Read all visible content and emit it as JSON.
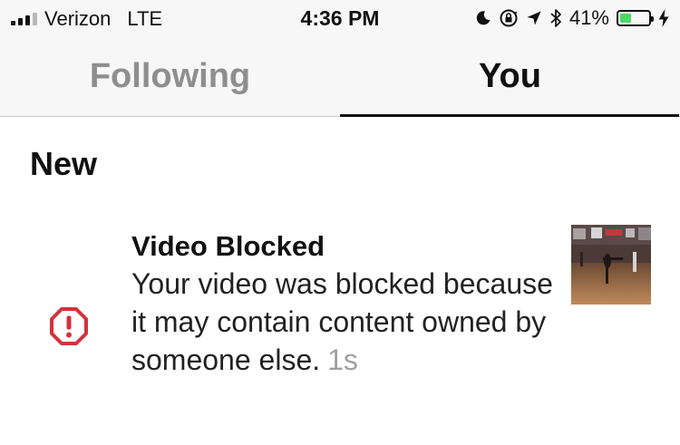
{
  "status_bar": {
    "carrier": "Verizon",
    "network": "LTE",
    "time": "4:36 PM",
    "battery_percent": "41%",
    "battery_level": 0.41,
    "icons": [
      "do-not-disturb-icon",
      "rotation-lock-icon",
      "location-icon",
      "bluetooth-icon",
      "charging-icon"
    ]
  },
  "tabs": [
    {
      "label": "Following",
      "active": false
    },
    {
      "label": "You",
      "active": true
    }
  ],
  "section": {
    "title": "New"
  },
  "notification": {
    "title": "Video Blocked",
    "body": "Your video was blocked because it may contain content owned by someone else.",
    "time": "1s",
    "icon": "alert-octagon-icon",
    "icon_color": "#d3323b"
  },
  "colors": {
    "active_tab": "#111111",
    "inactive_tab": "#8e8e8e",
    "battery": "#4cd964"
  }
}
